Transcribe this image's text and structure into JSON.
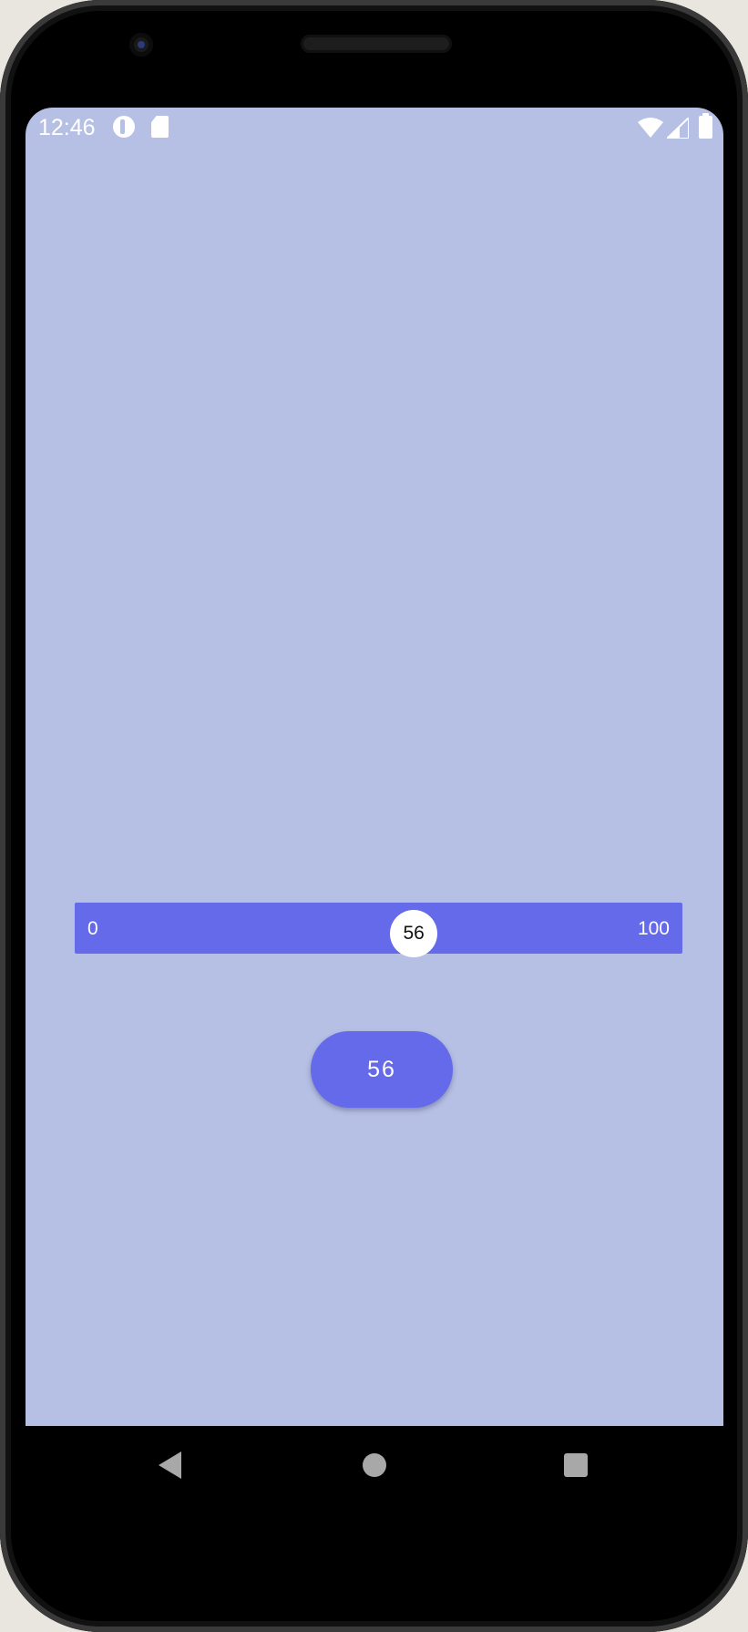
{
  "status_bar": {
    "time": "12:46",
    "icons": [
      "app-notification-icon",
      "sd-card-icon",
      "wifi-icon",
      "cellular-signal-icon",
      "battery-icon"
    ]
  },
  "slider": {
    "min_label": "0",
    "max_label": "100",
    "value": 56,
    "value_label": "56"
  },
  "value_button": {
    "label": "56"
  },
  "nav_bar": {
    "icons": [
      "back-icon",
      "home-icon",
      "recents-icon"
    ]
  },
  "colors": {
    "screen_background": "#b6c0e4",
    "accent": "#646aea",
    "thumb": "#ffffff"
  }
}
